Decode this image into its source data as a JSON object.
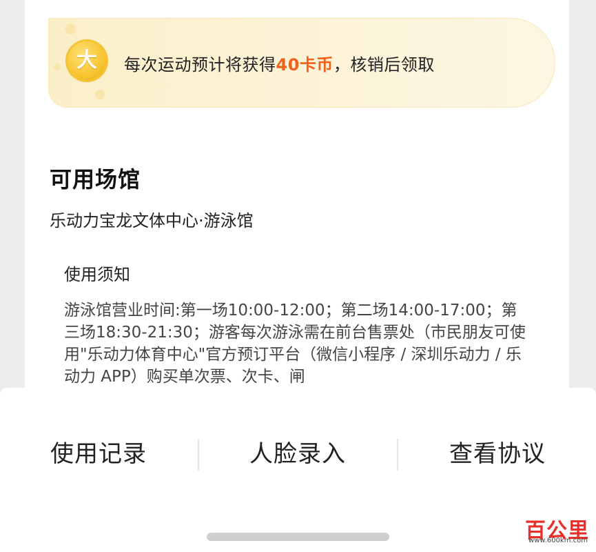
{
  "banner": {
    "coin_icon": "coin-icon",
    "coin_glyph": "大",
    "text_prefix": "每次运动预计将获得",
    "reward": "40卡币",
    "text_suffix": "，核销后领取",
    "accent_color": "#f0621a"
  },
  "venues": {
    "title": "可用场馆",
    "name": "乐动力宝龙文体中心·游泳馆"
  },
  "notice": {
    "title": "使用须知",
    "body": "游泳馆营业时间:第一场10:00-12:00；第二场14:00-17:00；第三场18:30-21:30；游客每次游泳需在前台售票处（市民朋友可使用\"乐动力体育中心\"官方预订平台（微信小程序 / 深圳乐动力 / 乐动力 APP）购买单次票、次卡、闸"
  },
  "actions": [
    {
      "label": "使用记录"
    },
    {
      "label": "人脸录入"
    },
    {
      "label": "查看协议"
    }
  ],
  "watermark": {
    "logo": "百公里",
    "url": "www.600km.com"
  }
}
